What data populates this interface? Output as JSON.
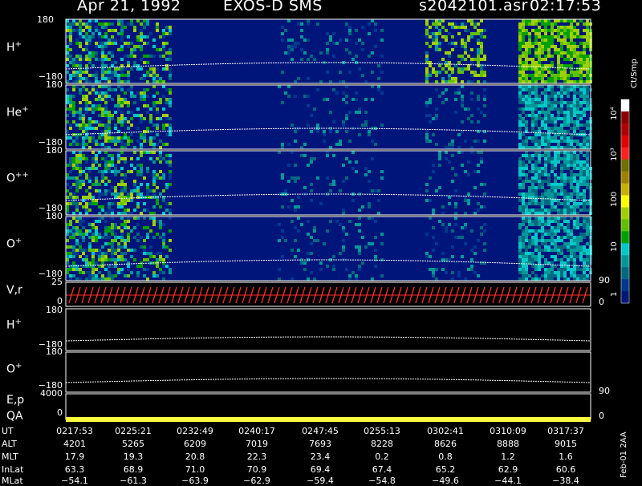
{
  "header": {
    "date": "Apr 21, 1992",
    "instrument": "EXOS-D SMS",
    "file": "s2042101.asr",
    "time": "02:17:53"
  },
  "panels": [
    {
      "label": "H",
      "sup": "+",
      "top_tick": "180",
      "bot_tick": "−180"
    },
    {
      "label": "He",
      "sup": "+",
      "top_tick": "180",
      "bot_tick": "−180"
    },
    {
      "label": "O",
      "sup": "++",
      "top_tick": "180",
      "bot_tick": "−180"
    },
    {
      "label": "O",
      "sup": "+",
      "top_tick": "180",
      "bot_tick": "−180"
    }
  ],
  "vr_panel": {
    "label": "V,r",
    "top_tick": "25",
    "bot_tick": "0",
    "right_top": "90",
    "right_bot": "0"
  },
  "h_line_panel": {
    "label": "H",
    "sup": "+",
    "top_tick": "180",
    "bot_tick": "−180"
  },
  "o_line_panel": {
    "label": "O",
    "sup": "+",
    "top_tick": "180",
    "bot_tick": "−180"
  },
  "ep_panel": {
    "label1": "E,p",
    "label2": "QA",
    "tick_top": "4000",
    "tick_bot": "0",
    "right_top": "90",
    "right_bot": "0"
  },
  "colorbar": {
    "unit": "Ct/Smp",
    "labels": [
      "10⁴",
      "10³",
      "100",
      "10",
      "1"
    ],
    "colors": [
      "#ffffff",
      "#8b0000",
      "#b00000",
      "#e00000",
      "#ff2020",
      "#707000",
      "#a08000",
      "#c8b000",
      "#ffff00",
      "#a0d000",
      "#60c000",
      "#00a000",
      "#00c8c8",
      "#009898",
      "#006880",
      "#003890",
      "#001878"
    ]
  },
  "ephemeris": {
    "labels": [
      "UT",
      "ALT",
      "MLT",
      "InLat",
      "MLat"
    ],
    "columns": [
      [
        "0217:53",
        "4201",
        "17.9",
        "63.3",
        "−54.1"
      ],
      [
        "0225:21",
        "5265",
        "19.3",
        "68.9",
        "−61.3"
      ],
      [
        "0232:49",
        "6209",
        "20.8",
        "71.0",
        "−63.9"
      ],
      [
        "0240:17",
        "7019",
        "22.3",
        "70.9",
        "−62.9"
      ],
      [
        "0247:45",
        "7693",
        "23.4",
        "69.4",
        "−59.4"
      ],
      [
        "0255:13",
        "8228",
        "0.2",
        "67.4",
        "−54.8"
      ],
      [
        "0302:41",
        "8626",
        "0.8",
        "65.2",
        "−49.6"
      ],
      [
        "0310:09",
        "8888",
        "1.2",
        "62.9",
        "−44.1"
      ],
      [
        "0317:37",
        "9015",
        "1.6",
        "60.6",
        "−38.4"
      ]
    ]
  },
  "footer": "Feb-01 2AA",
  "chart_data": {
    "type": "heatmap",
    "title": "Apr 21, 1992   EXOS-D SMS",
    "x": [
      "0217:53",
      "0225:21",
      "0232:49",
      "0240:17",
      "0247:45",
      "0255:13",
      "0302:41",
      "0310:09",
      "0317:37"
    ],
    "xlabel": "UT",
    "series": [
      {
        "name": "H+",
        "ylim": [
          -180,
          180
        ]
      },
      {
        "name": "He+",
        "ylim": [
          -180,
          180
        ]
      },
      {
        "name": "O++",
        "ylim": [
          -180,
          180
        ]
      },
      {
        "name": "O+",
        "ylim": [
          -180,
          180
        ]
      }
    ],
    "colorbar_unit": "Ct/Smp",
    "colorbar_range": [
      1,
      10000
    ]
  }
}
